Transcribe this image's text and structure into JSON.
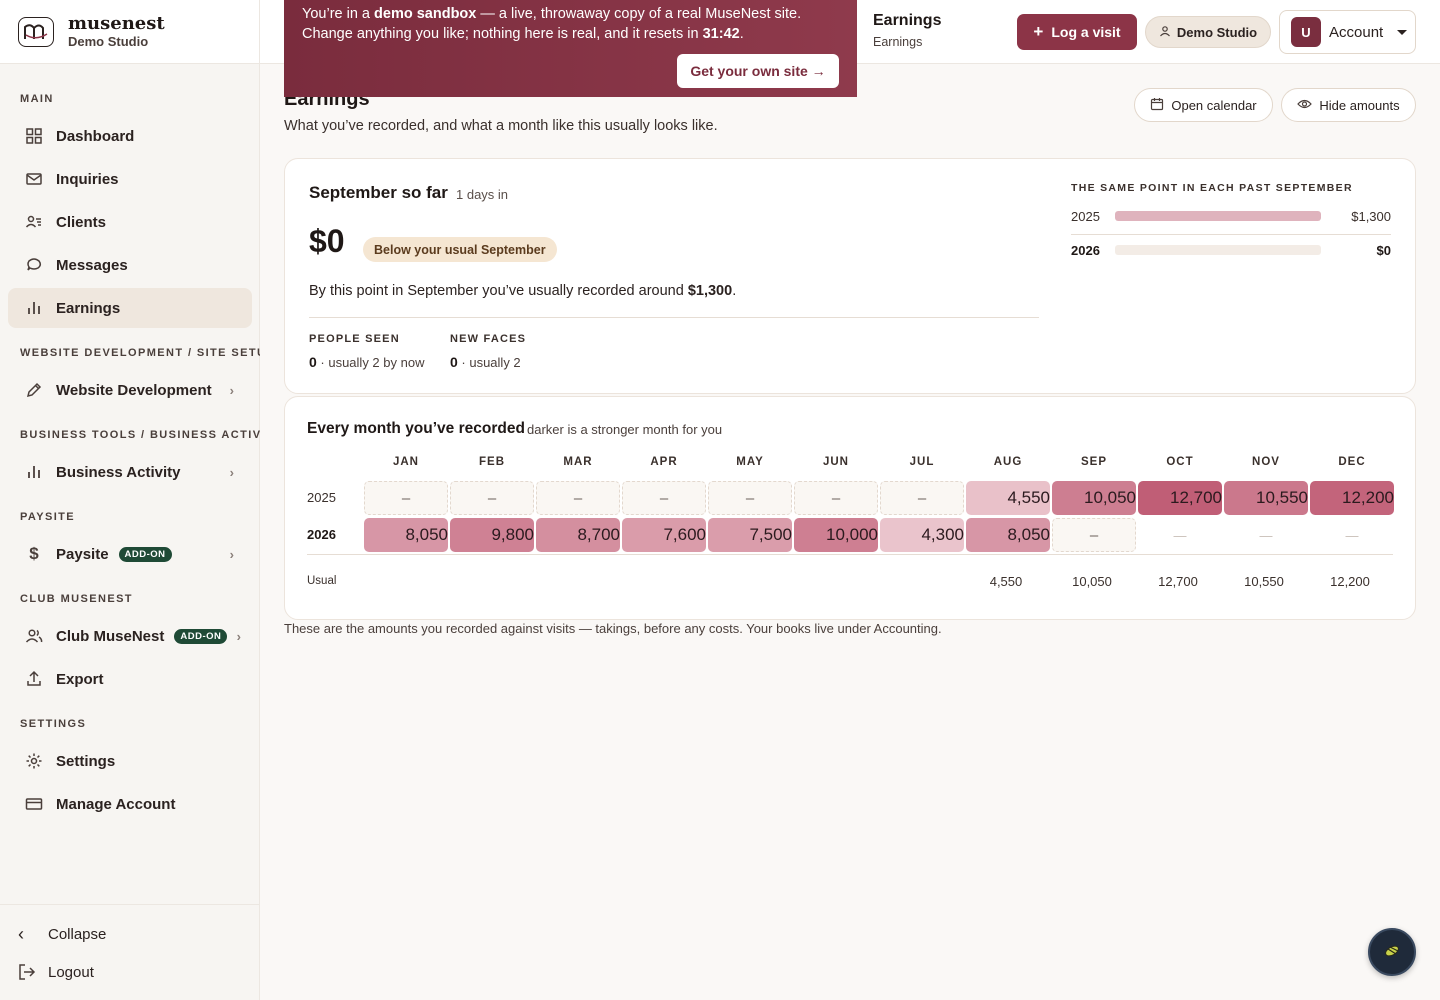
{
  "brand": {
    "name": "musenest",
    "studio": "Demo Studio"
  },
  "sidebar": {
    "sections": {
      "main": "MAIN",
      "website": "WEBSITE DEVELOPMENT / SITE SETUP",
      "business": "BUSINESS TOOLS / BUSINESS ACTIVITY",
      "paysite": "PAYSITE",
      "club": "CLUB MUSENEST",
      "settings": "SETTINGS"
    },
    "items": {
      "dashboard": "Dashboard",
      "inquiries": "Inquiries",
      "clients": "Clients",
      "messages": "Messages",
      "earnings": "Earnings",
      "website": "Website Development",
      "business": "Business Activity",
      "paysite": "Paysite",
      "club": "Club MuseNest",
      "export": "Export",
      "settings": "Settings",
      "manage": "Manage Account"
    },
    "addon_label": "ADD-ON",
    "collapse": "Collapse",
    "logout": "Logout"
  },
  "topbar": {
    "crumb_title": "Earnings",
    "crumb_sub": "Earnings",
    "log_visit": "Log a visit",
    "studio": "Demo Studio",
    "account_initial": "U",
    "account": "Account"
  },
  "banner": {
    "pre": "You’re in a ",
    "bold1": "demo sandbox",
    "mid": " — a live, throwaway copy of a real MuseNest site. Change anything you like; nothing here is real, and it resets in ",
    "timer": "31:42",
    "end": ".",
    "cta": "Get your own site →"
  },
  "page": {
    "title": "Earnings",
    "subtitle": "What you’ve recorded, and what a month like this usually looks like.",
    "open_calendar": "Open calendar",
    "hide_amounts": "Hide amounts"
  },
  "sofar": {
    "title": "September so far",
    "days": "1 days in",
    "amount": "$0",
    "badge": "Below your usual September",
    "usual_pre": "By this point in September you’ve usually recorded around ",
    "usual_amount": "$1,300",
    "usual_post": ".",
    "people_label": "PEOPLE SEEN",
    "people_val": "0",
    "people_note": " · usually 2 by now",
    "faces_label": "NEW FACES",
    "faces_val": "0",
    "faces_note": " · usually 2"
  },
  "past": {
    "heading": "THE SAME POINT IN EACH PAST SEPTEMBER",
    "rows": [
      {
        "year": "2025",
        "amount": "$1,300",
        "fraction": 1.0
      },
      {
        "year": "2026",
        "amount": "$0",
        "fraction": 0.0
      }
    ]
  },
  "grid": {
    "title": "Every month you’ve recorded",
    "hint": "darker is a stronger month for you",
    "months": [
      "JAN",
      "FEB",
      "MAR",
      "APR",
      "MAY",
      "JUN",
      "JUL",
      "AUG",
      "SEP",
      "OCT",
      "NOV",
      "DEC"
    ],
    "rows": [
      {
        "year": "2025",
        "cells": [
          "–",
          "–",
          "–",
          "–",
          "–",
          "–",
          "–",
          "4,550",
          "10,050",
          "12,700",
          "10,550",
          "12,200"
        ]
      },
      {
        "year": "2026",
        "cells": [
          "8,050",
          "9,800",
          "8,700",
          "7,600",
          "7,500",
          "10,000",
          "4,300",
          "8,050",
          "–",
          "—",
          "—",
          "—"
        ]
      }
    ],
    "usual_label": "Usual",
    "usual": [
      "",
      "",
      "",
      "",
      "",
      "",
      "",
      "4,550",
      "10,050",
      "12,700",
      "10,550",
      "12,200"
    ]
  },
  "footnote": "These are the amounts you recorded against visits — takings, before any costs. Your books live under Accounting.",
  "colors": {
    "accent": "#8c3447",
    "addon": "#1f4a36",
    "badge": "#f5e6d2"
  }
}
